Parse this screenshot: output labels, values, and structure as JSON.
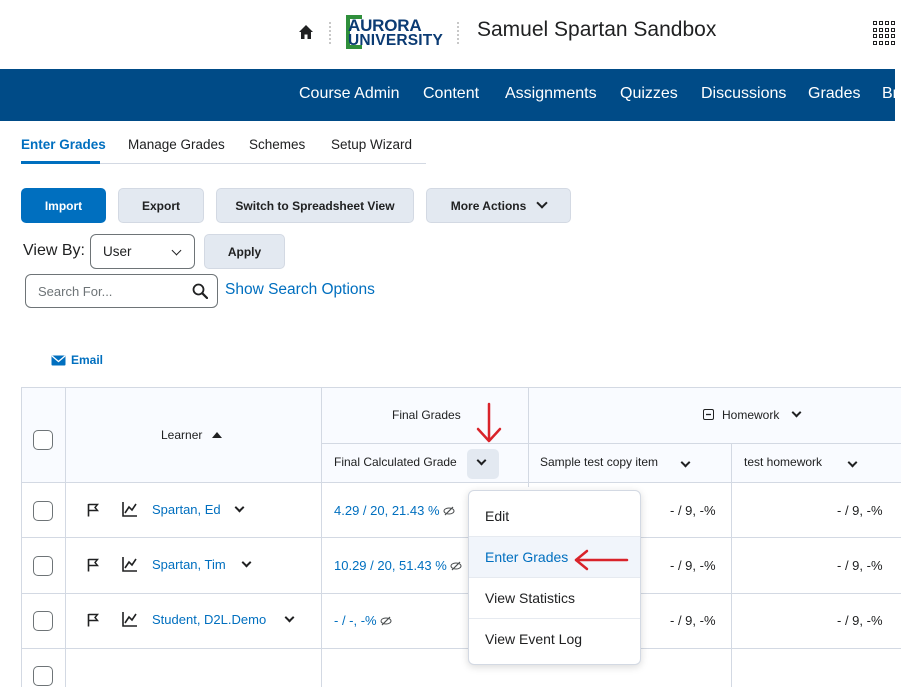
{
  "header": {
    "logo_line1": "AURORA",
    "logo_line2": "UNIVERSITY",
    "site_title": "Samuel Spartan Sandbox"
  },
  "navbar": {
    "items": [
      "Course Admin",
      "Content",
      "Assignments",
      "Quizzes",
      "Discussions",
      "Grades",
      "Br"
    ]
  },
  "tabs": [
    "Enter Grades",
    "Manage Grades",
    "Schemes",
    "Setup Wizard"
  ],
  "toolbar": {
    "import": "Import",
    "export": "Export",
    "switch_view": "Switch to Spreadsheet View",
    "more_actions": "More Actions"
  },
  "viewby": {
    "label": "View By:",
    "selected": "User",
    "apply": "Apply"
  },
  "search": {
    "placeholder": "Search For...",
    "options_link": "Show Search Options"
  },
  "email_link": "Email",
  "grid": {
    "learner_header": "Learner",
    "final_grades_header": "Final Grades",
    "final_calc_header": "Final Calculated Grade",
    "homework_header": "Homework",
    "col_sample": "Sample test copy item",
    "col_test_hw": "test homework",
    "rows": [
      {
        "name": "Spartan, Ed",
        "final": "4.29 / 20, 21.43 %",
        "sample": "- / 9, -%",
        "hw": "- / 9, -%"
      },
      {
        "name": "Spartan, Tim",
        "final": "10.29 / 20, 51.43 %",
        "sample": "- / 9, -%",
        "hw": "- / 9, -%"
      },
      {
        "name": "Student, D2L.Demo",
        "final": "- / -, -%",
        "sample": "- / 9, -%",
        "hw": "- / 9, -%"
      }
    ]
  },
  "context_menu": {
    "items": [
      "Edit",
      "Enter Grades",
      "View Statistics",
      "View Event Log"
    ]
  },
  "colors": {
    "navbar": "#004b87",
    "accent": "#006fbf",
    "annotation": "#d9232a"
  }
}
